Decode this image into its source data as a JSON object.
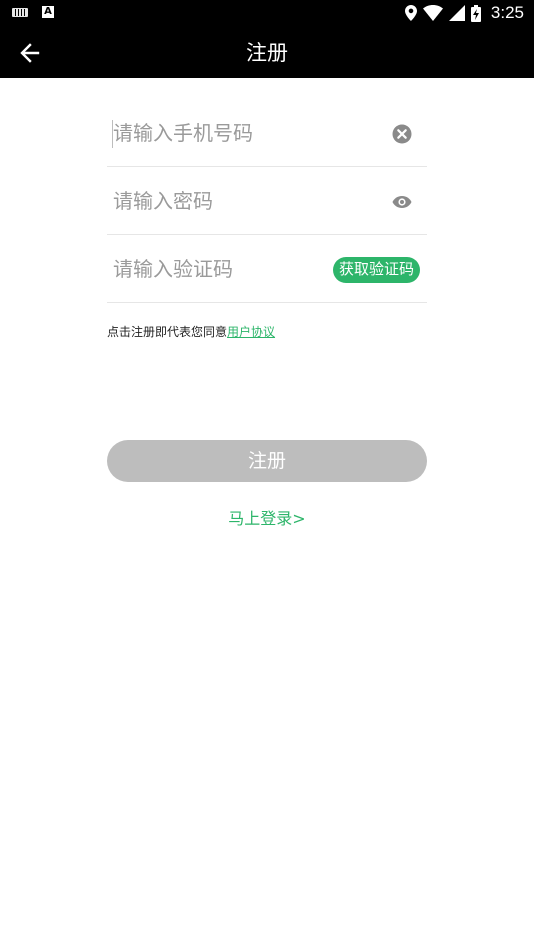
{
  "status_bar": {
    "time": "3:25",
    "icons": [
      "keyboard-icon",
      "a-notification-icon",
      "location-icon",
      "wifi-icon",
      "signal-icon",
      "battery-charging-icon"
    ]
  },
  "app_bar": {
    "title": "注册",
    "back_icon": "arrow-left-icon"
  },
  "form": {
    "phone_placeholder": "请输入手机号码",
    "phone_value": "",
    "password_placeholder": "请输入密码",
    "password_value": "",
    "code_placeholder": "请输入验证码",
    "code_value": "",
    "get_code_label": "获取验证码"
  },
  "agreement": {
    "prefix": "点击注册即代表您同意",
    "link_text": "用户协议"
  },
  "register_button": "注册",
  "login_link": "马上登录>",
  "colors": {
    "accent": "#2db56a",
    "disabled_button": "#bdbdbd",
    "bar_background": "#000000"
  }
}
